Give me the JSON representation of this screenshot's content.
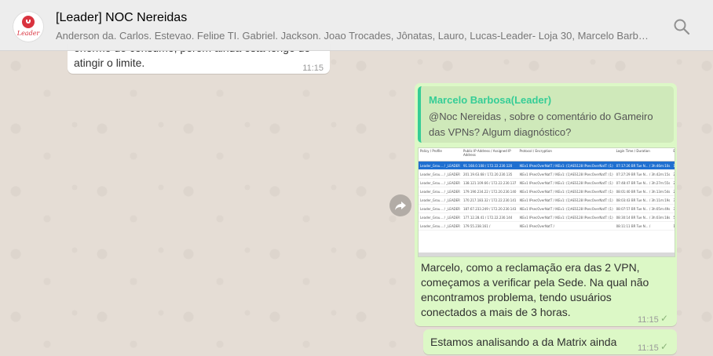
{
  "header": {
    "title": "[Leader] NOC Nereidas",
    "members": "Anderson da, Carlos, Estevao, Felipe TI, Gabriel, Jackson, Joao Trocades, Jônatas, Lauro, Lucas-Leader- Loja 30, Marcelo Barbosa(Le...",
    "avatar_text": "Leader",
    "icons": {
      "search": "search-icon",
      "forward": "forward-icon"
    }
  },
  "messages": [
    {
      "id": "m1",
      "direction": "incoming",
      "text_line1": "enorme de consumo, porém ainda está longe do",
      "text_line2": "atingir o limite.",
      "time": "11:15"
    },
    {
      "id": "m2",
      "direction": "outgoing",
      "quote_author": "Marcelo Barbosa(Leader)",
      "quote_text": "@Noc Nereidas , sobre o comentário do Gameiro das VPNs? Algum diagnóstico?",
      "text": "Marcelo, como a reclamação era das 2 VPN, começamos a verificar pela Sede. Na qual não encontramos problema, tendo usuários conectados a mais de 3 horas.",
      "time": "11:15",
      "status": "read"
    },
    {
      "id": "m3",
      "direction": "outgoing",
      "text": "Estamos analisando a da Matrix ainda",
      "time": "11:15",
      "status": "read"
    }
  ],
  "screenshot": {
    "headers": [
      "Policy / Profile",
      "Public IP Address / Assigned IP Address",
      "Protocol / Encryption",
      "Login Time / Duration",
      "Bytes Tx / Bytes Rx",
      "Audit Session ID"
    ],
    "rows": [
      [
        "Leader_Grou... / _LEADER",
        "91.168.0.108 / 172.22.230.120",
        "IKEv1 IPsecOverNatT / IKEv1: (1)AES128 IPsecOverNatT: (1)",
        "07:17:26 BR Tue N... / 3h:46m:10s",
        "18943064 / 3305841",
        "ac1a790330c0830..."
      ],
      [
        "Leader_Grou... / _LEADER",
        "201.19.63.68 / 172.20.230.135",
        "IKEv1 IPsecOverNatT / IKEv1: (1)AES128 IPsecOverNatT: (1)",
        "07:27:29 BR Tue N... / 3h:42m:15s",
        "23532013 / 76637547",
        "ac1ef90430e0830..."
      ],
      [
        "Leader_Grou... / _LEADER",
        "138.121.109.66 / 172.22.230.137",
        "IKEv1 IPsecOverNatT / IKEv1: (1)AES128 IPsecOverNatT: (1)",
        "07:48:47 BR Tue N... / 3h:27m:55s",
        "222989775 / 79466520",
        "ac1a790330c0830..."
      ],
      [
        "Leader_Grou... / _LEADER",
        "179.190.234.22 / 172.20.230.140",
        "IKEv1 IPsecOverNatT / IKEv1: (1)AES128 IPsecOverNatT: (1)",
        "08:01:40 BR Tue N... / 3h:13m:54s",
        "29339453 / 4078592",
        "ac1ef90430e0830..."
      ],
      [
        "Leader_Grou... / _LEADER",
        "170.217.183.32 / 172.22.230.141",
        "IKEv1 IPsecOverNatT / IKEv1: (1)AES128 IPsecOverNatT: (1)",
        "08:03:43 BR Tue N... / 3h:11m:19s",
        "37678999 / 6729070",
        "ac1a790330c0830..."
      ],
      [
        "Leader_Grou... / _LEADER",
        "187.67.233.249 / 172.20.230.143",
        "IKEv1 IPsecOverNatT / IKEv1: (1)AES128 IPsecOverNatT: (1)",
        "08:07:57 BR Tue N... / 3h:05m:49s",
        "35355242 / 4091583",
        "ac1ef90430e0830..."
      ],
      [
        "Leader_Grou... / _LEADER",
        "177.12.28.41 / 172.22.230.144",
        "IKEv1 IPsecOverNatT / IKEv1: (1)AES128 IPsecOverNatT: (1)",
        "08:30:14 BR Tue N... / 3h:03m:18s",
        "53851442 / 179338893",
        "ac1a790330c0830..."
      ],
      [
        "Leader_Grou... / _LEADER",
        "179.55.238.161 / ",
        "IKEv1 IPsecOverNatT / ",
        "08:11:11 BR Tue N... / ",
        "14449944 / ",
        "ac1ef90430e0830..."
      ]
    ],
    "selected_row": 0
  },
  "colors": {
    "chat_background": "#e5ddd5",
    "outgoing_bubble": "#dcf8c6",
    "incoming_bubble": "#ffffff",
    "quote_accent": "#35cd96",
    "header_background": "#ededed"
  }
}
